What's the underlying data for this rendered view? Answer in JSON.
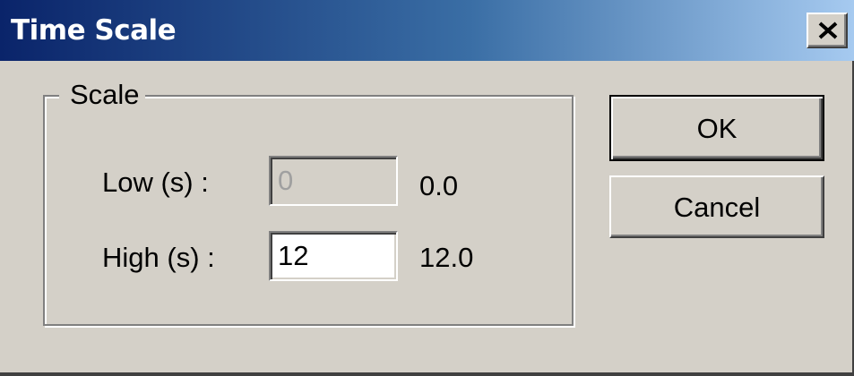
{
  "window": {
    "title": "Time Scale",
    "close_icon": "close-icon",
    "colors": {
      "titlebar_start": "#0a246a",
      "titlebar_end": "#a6caf0",
      "face": "#d4d0c8"
    }
  },
  "scale_group": {
    "label": "Scale",
    "low": {
      "label": "Low (s) :",
      "value": "0",
      "readout": "0.0",
      "enabled": false
    },
    "high": {
      "label": "High (s) :",
      "value": "12",
      "readout": "12.0",
      "enabled": true
    }
  },
  "buttons": {
    "ok_label": "OK",
    "cancel_label": "Cancel"
  }
}
